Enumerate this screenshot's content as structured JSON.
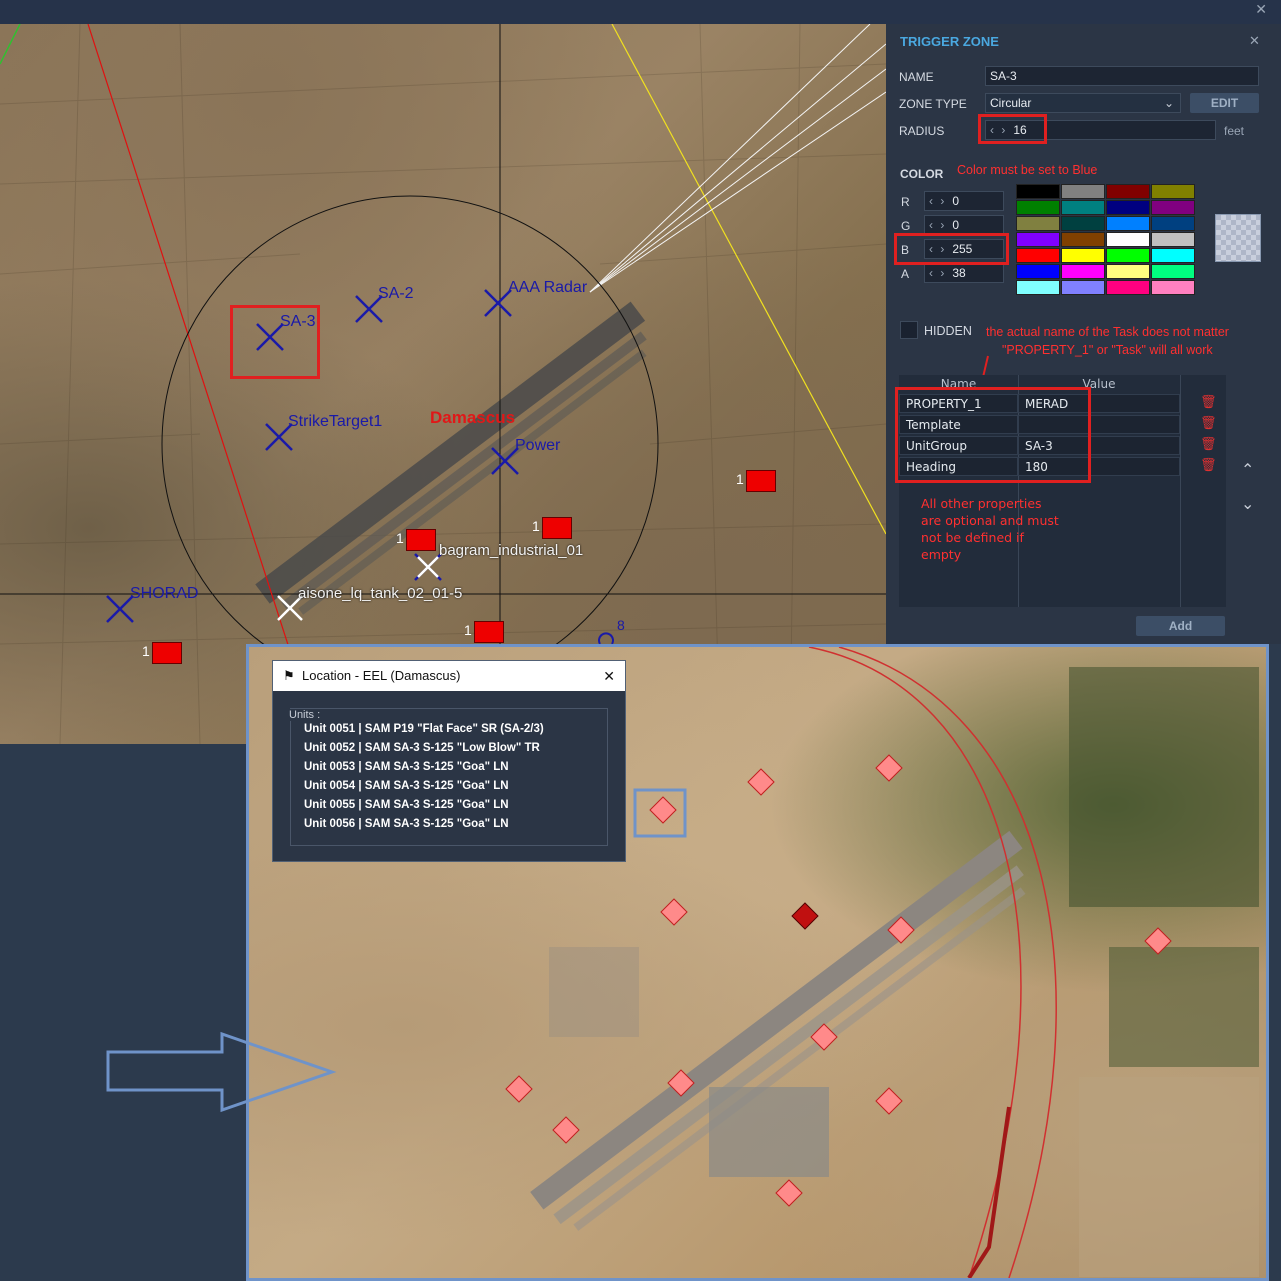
{
  "topbar": {
    "close_glyph": "✕"
  },
  "map": {
    "labels": {
      "sa3": "SA-3",
      "sa2": "SA-2",
      "aaa": "AAA Radar",
      "strike": "StrikeTarget1",
      "power": "Power",
      "shorad": "SHORAD",
      "bagram": "bagram_industrial_01",
      "damascus": "Damascus",
      "mixed": "aisone_lq_tank_02_01-5",
      "eight": "8"
    },
    "counts": [
      "1",
      "1",
      "1",
      "1",
      "1",
      "1"
    ]
  },
  "panel": {
    "title": "TRIGGER ZONE",
    "close_glyph": "✕",
    "name_label": "NAME",
    "name_value": "SA-3",
    "zone_type_label": "ZONE TYPE",
    "zone_type_value": "Circular",
    "edit_button": "EDIT",
    "radius_label": "RADIUS",
    "radius_value": "16",
    "radius_unit": "feet",
    "color_label": "COLOR",
    "color_note": "Color must be set to Blue",
    "channels": [
      {
        "label": "R",
        "value": "0"
      },
      {
        "label": "G",
        "value": "0"
      },
      {
        "label": "B",
        "value": "255"
      },
      {
        "label": "A",
        "value": "38"
      }
    ],
    "swatches": [
      "#000000",
      "#808080",
      "#800000",
      "#808000",
      "#008000",
      "#008080",
      "#000080",
      "#800080",
      "#808040",
      "#004040",
      "#0080ff",
      "#004080",
      "#8000ff",
      "#804000",
      "#ffffff",
      "#c0c0c0",
      "#ff0000",
      "#ffff00",
      "#00ff00",
      "#00ffff",
      "#0000ff",
      "#ff00ff",
      "#ffff80",
      "#00ff80",
      "#80ffff",
      "#8080ff",
      "#ff0080",
      "#ff80c0"
    ],
    "hidden_label": "HIDDEN",
    "task_note_1": "the actual name of the Task does not matter",
    "task_note_2": "\"PROPERTY_1\" or \"Task\" will all work",
    "table_headers": {
      "name": "Name",
      "value": "Value"
    },
    "properties": [
      {
        "name": "PROPERTY_1",
        "value": "MERAD"
      },
      {
        "name": "Template",
        "value": ""
      },
      {
        "name": "UnitGroup",
        "value": "SA-3"
      },
      {
        "name": "Heading",
        "value": "180"
      }
    ],
    "optional_note": [
      "All other properties",
      "are optional and must",
      "not be defined if",
      "empty"
    ],
    "add_button": "Add",
    "up_glyph": "⌃",
    "down_glyph": "⌄",
    "trash_glyph": "🗑"
  },
  "location_window": {
    "title": "Location - EEL (Damascus)",
    "close_glyph": "✕",
    "units_label": "Units :",
    "units": [
      "Unit 0051 | SAM P19 \"Flat Face\" SR (SA-2/3)",
      "Unit 0052 | SAM SA-3 S-125 \"Low Blow\" TR",
      "Unit 0053 | SAM SA-3 S-125 \"Goa\" LN",
      "Unit 0054 | SAM SA-3 S-125 \"Goa\" LN",
      "Unit 0055 | SAM SA-3 S-125 \"Goa\" LN",
      "Unit 0056 | SAM SA-3 S-125 \"Goa\" LN"
    ]
  },
  "colors": {
    "accent": "#3fa0d8",
    "annotation_red": "#e02020",
    "inset_border": "#6f93c9",
    "marker_blue": "#1a1aa8"
  }
}
